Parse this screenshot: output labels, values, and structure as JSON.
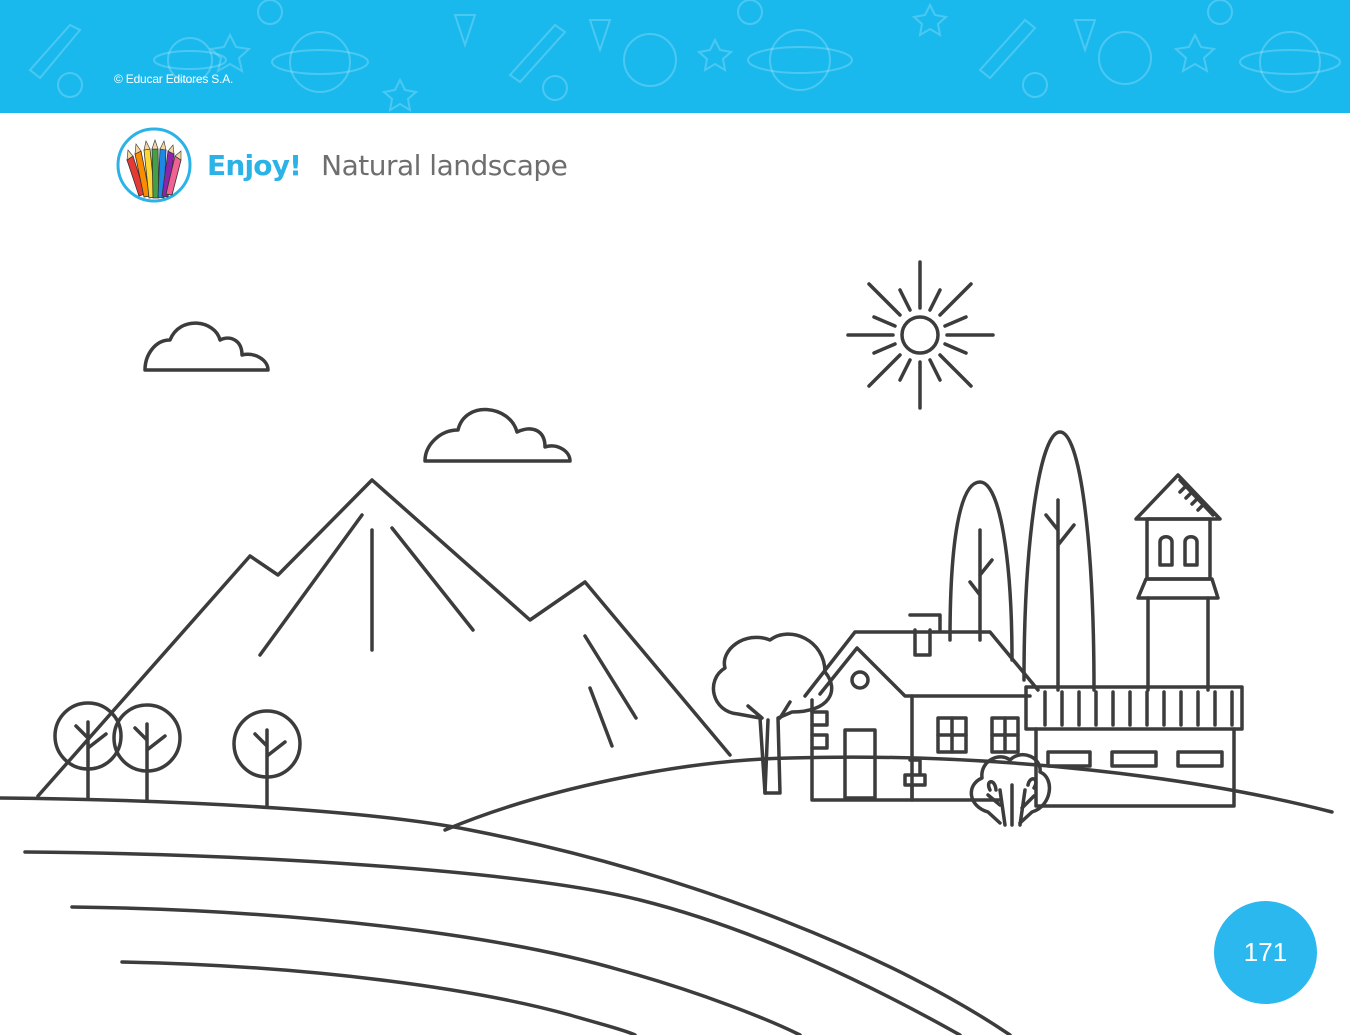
{
  "header": {
    "copyright": "© Educar Editores S.A.",
    "background_color": "#19b9ee"
  },
  "title": {
    "icon": "colored-pencils-icon",
    "label": "Enjoy!",
    "text": "Natural landscape",
    "label_color": "#2bb3e8",
    "text_color": "#6e6e6e"
  },
  "illustration": {
    "line_color": "#3c3c3c",
    "elements": [
      "sun",
      "cloud",
      "cloud",
      "mountains",
      "tree",
      "tree",
      "tree",
      "house",
      "cypress-tree",
      "cypress-tree",
      "tower",
      "bush",
      "round-tree",
      "building",
      "hills"
    ]
  },
  "footer": {
    "page_number": "171",
    "badge_color": "#2bb8ef"
  }
}
